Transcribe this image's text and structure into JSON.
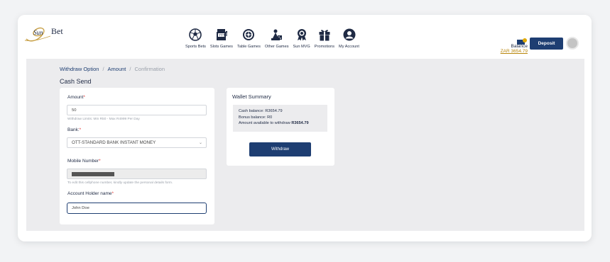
{
  "brand": {
    "logo_text": "Bet",
    "logo_script": "Sun"
  },
  "nav": [
    {
      "label": "Sports Bets",
      "icon": "soccer-ball-icon"
    },
    {
      "label": "Slots Games",
      "icon": "slot-machine-icon"
    },
    {
      "label": "Table Games",
      "icon": "roulette-wheel-icon"
    },
    {
      "label": "Other Games",
      "icon": "game-pieces-icon"
    },
    {
      "label": "Sun MVG",
      "icon": "award-ribbon-icon"
    },
    {
      "label": "Promotions",
      "icon": "gift-icon"
    },
    {
      "label": "My Account",
      "icon": "user-icon"
    }
  ],
  "account": {
    "balance_label": "Balance",
    "balance_value": "ZAR 3654.79",
    "deposit_label": "Deposit"
  },
  "breadcrumb": {
    "step1": "Withdraw Option",
    "sep": "/",
    "step2": "Amount",
    "step3": "Confirmation"
  },
  "page_title": "Cash Send",
  "form": {
    "amount_label": "Amount",
    "amount_value": "50",
    "amount_hint": "Withdraw Limits: Min R50 - Max R4999 Per Day",
    "bank_label": "Bank:",
    "bank_value": "OTT-STANDARD BANK INSTANT MONEY",
    "mobile_label": "Mobile Number",
    "mobile_hint": "To edit this cellphone number, kindly update the personal details form.",
    "holder_label": "Account Holder name",
    "holder_value": "John Doe",
    "required_mark": "*"
  },
  "wallet": {
    "title": "Wallet Summary",
    "cash_balance": "Cash balance: R3654.79",
    "bonus_balance": "Bonus balance: R0",
    "available_label": "Amount available to withdraw ",
    "available_value": "R3654.79",
    "withdraw_label": "Withdraw"
  },
  "colors": {
    "primary": "#1e3e72",
    "accent_gold": "#b8860b",
    "required": "#e53935"
  }
}
